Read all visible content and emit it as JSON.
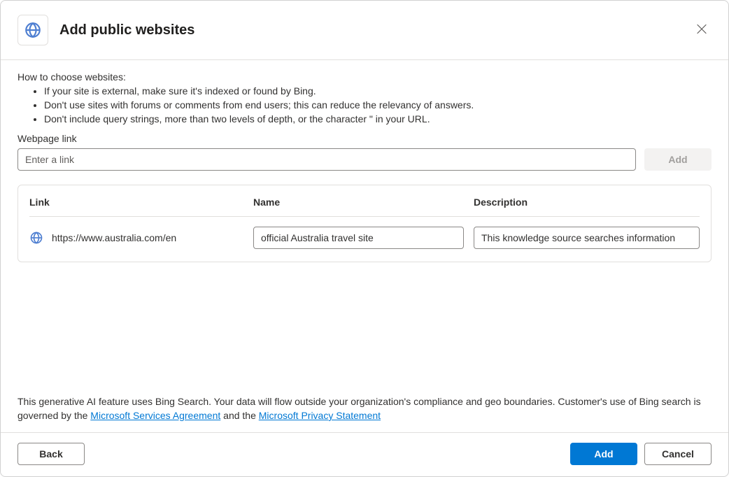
{
  "header": {
    "title": "Add public websites"
  },
  "help": {
    "heading": "How to choose websites:",
    "bullets": [
      "If your site is external, make sure it's indexed or found by Bing.",
      "Don't use sites with forums or comments from end users; this can reduce the relevancy of answers.",
      "Don't include query strings, more than two levels of depth, or the character \" in your URL."
    ]
  },
  "linkField": {
    "label": "Webpage link",
    "placeholder": "Enter a link",
    "addLabel": "Add"
  },
  "table": {
    "headers": {
      "link": "Link",
      "name": "Name",
      "description": "Description"
    },
    "rows": [
      {
        "link": "https://www.australia.com/en",
        "name": "official Australia travel site",
        "description": "This knowledge source searches information"
      }
    ]
  },
  "disclaimer": {
    "before": "This generative AI feature uses Bing Search. Your data will flow outside your organization's compliance and geo boundaries. Customer's use of Bing search is governed by the ",
    "link1": "Microsoft Services Agreement",
    "between": " and the ",
    "link2": "Microsoft Privacy Statement"
  },
  "footer": {
    "back": "Back",
    "add": "Add",
    "cancel": "Cancel"
  }
}
